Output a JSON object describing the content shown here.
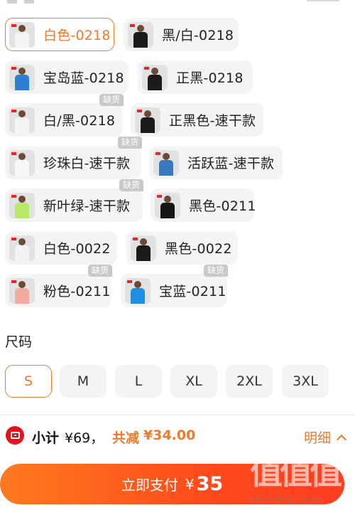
{
  "colors_section": {
    "options": [
      {
        "label": "白色-0218",
        "selected": true,
        "out_of_stock": false,
        "shirt_color": "#f4f4f4"
      },
      {
        "label": "黑/白-0218",
        "selected": false,
        "out_of_stock": false,
        "shirt_color": "#1b1b1b"
      },
      {
        "label": "宝岛蓝-0218",
        "selected": false,
        "out_of_stock": false,
        "shirt_color": "#2e7fd0"
      },
      {
        "label": "正黑-0218",
        "selected": false,
        "out_of_stock": false,
        "shirt_color": "#1b1b1b"
      },
      {
        "label": "白/黑-0218",
        "selected": false,
        "out_of_stock": true,
        "shirt_color": "#f4f4f4"
      },
      {
        "label": "正黑色-速干款",
        "selected": false,
        "out_of_stock": false,
        "shirt_color": "#1b1b1b"
      },
      {
        "label": "珍珠白-速干款",
        "selected": false,
        "out_of_stock": true,
        "shirt_color": "#f7f7f7"
      },
      {
        "label": "活跃蓝-速干款",
        "selected": false,
        "out_of_stock": false,
        "shirt_color": "#3b78c0"
      },
      {
        "label": "新叶绿-速干款",
        "selected": false,
        "out_of_stock": true,
        "shirt_color": "#b8ea6a"
      },
      {
        "label": "黑色-0211",
        "selected": false,
        "out_of_stock": false,
        "shirt_color": "#151515"
      },
      {
        "label": "白色-0022",
        "selected": false,
        "out_of_stock": false,
        "shirt_color": "#f2f2f2"
      },
      {
        "label": "黑色-0022",
        "selected": false,
        "out_of_stock": false,
        "shirt_color": "#1a1a1a"
      },
      {
        "label": "粉色-0211",
        "selected": false,
        "out_of_stock": true,
        "shirt_color": "#f2a9a0"
      },
      {
        "label": "宝蓝-0211",
        "selected": false,
        "out_of_stock": true,
        "shirt_color": "#1f8ee0"
      }
    ],
    "out_of_stock_badge": "缺货"
  },
  "size_section": {
    "title": "尺码",
    "options": [
      {
        "label": "S",
        "selected": true
      },
      {
        "label": "M",
        "selected": false
      },
      {
        "label": "L",
        "selected": false
      },
      {
        "label": "XL",
        "selected": false
      },
      {
        "label": "2XL",
        "selected": false
      },
      {
        "label": "3XL",
        "selected": false
      }
    ]
  },
  "summary": {
    "subtotal_label": "小计",
    "subtotal_value": "¥69，",
    "discount_label": "共减",
    "discount_value": "¥34.00",
    "detail_label": "明细",
    "coupon_icon": "coupon-icon"
  },
  "pay_button": {
    "label": "立即支付",
    "currency": "¥",
    "amount": "35"
  },
  "watermark": {
    "glyphs": "值值值",
    "url": "zhizhizhi.com"
  },
  "accent_color": "#f07a2a",
  "pay_gradient": [
    "#ff7a1f",
    "#ff3d20"
  ]
}
